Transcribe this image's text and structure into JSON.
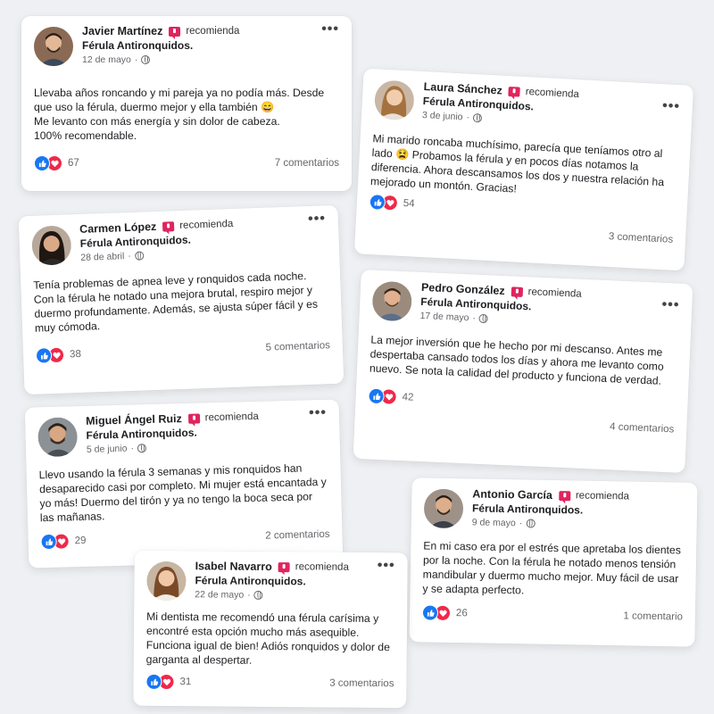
{
  "recommend_label": "recomienda",
  "product_label": "Férula Antironquidos.",
  "posts": [
    {
      "name": "Javier Martínez",
      "date": "12 de mayo",
      "text": "Llevaba años roncando y mi pareja ya no podía más. Desde que uso la férula, duermo mejor y ella también 😄\nMe levanto con más energía y sin dolor de cabeza.\n100% recomendable.",
      "reactions": "67",
      "comments": "7 comentarios"
    },
    {
      "name": "Laura Sánchez",
      "date": "3 de junio",
      "text": "Mi marido roncaba muchísimo, parecía que teníamos otro al lado 😫 Probamos la férula y en pocos días notamos la diferencia. Ahora descansamos los dos y nuestra relación ha mejorado un montón. Gracias!",
      "reactions": "54",
      "comments": "3 comentarios"
    },
    {
      "name": "Carmen López",
      "date": "28 de abril",
      "text": "Tenía problemas de apnea leve y ronquidos cada noche. Con la férula he notado una mejora brutal, respiro mejor y duermo profundamente. Además, se ajusta súper fácil y es muy cómoda.",
      "reactions": "38",
      "comments": "5 comentarios"
    },
    {
      "name": "Pedro González",
      "date": "17 de mayo",
      "text": "La mejor inversión que he hecho por mi descanso. Antes me despertaba cansado todos los días y ahora me levanto como nuevo. Se nota la calidad del producto y funciona de verdad.",
      "reactions": "42",
      "comments": "4 comentarios"
    },
    {
      "name": "Miguel Ángel Ruiz",
      "date": "5 de junio",
      "text": "Llevo usando la férula 3 semanas y mis ronquidos han desaparecido casi por completo. Mi mujer está encantada y yo más! Duermo del tirón y ya no tengo la boca seca por las mañanas.",
      "reactions": "29",
      "comments": "2 comentarios"
    },
    {
      "name": "Antonio García",
      "date": "9 de mayo",
      "text": "En mi caso era por el estrés que apretaba los dientes por la noche. Con la férula he notado menos tensión mandibular y duermo mucho mejor. Muy fácil de usar y se adapta perfecto.",
      "reactions": "26",
      "comments": "1 comentario"
    },
    {
      "name": "Isabel Navarro",
      "date": "22 de mayo",
      "text": "Mi dentista me recomendó una férula carísima y encontré esta opción mucho más asequible. Funciona igual de bien! Adiós ronquidos y dolor de garganta al despertar.",
      "reactions": "31",
      "comments": "3 comentarios"
    }
  ],
  "colors": {
    "background": "#eef0f3",
    "like": "#1877f2",
    "love": "#f0284a",
    "recommend_badge": "#e0245e"
  }
}
